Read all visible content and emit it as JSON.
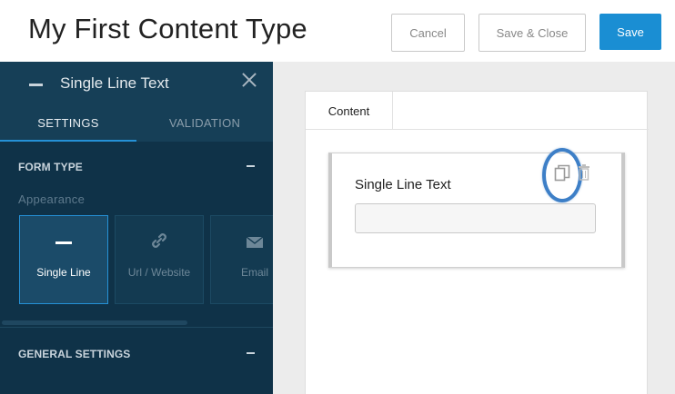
{
  "header": {
    "title": "My First Content Type",
    "cancel_label": "Cancel",
    "save_close_label": "Save & Close",
    "save_label": "Save"
  },
  "sidebar": {
    "field_title": "Single Line Text",
    "tabs": [
      {
        "label": "SETTINGS",
        "active": true
      },
      {
        "label": "VALIDATION",
        "active": false
      }
    ],
    "form_type": {
      "heading": "FORM TYPE",
      "appearance_label": "Appearance",
      "options": [
        {
          "label": "Single Line",
          "icon": "dash-icon",
          "selected": true
        },
        {
          "label": "Url / Website",
          "icon": "link-icon",
          "selected": false
        },
        {
          "label": "Email",
          "icon": "envelope-icon",
          "selected": false
        }
      ]
    },
    "general_settings": {
      "heading": "GENERAL SETTINGS"
    }
  },
  "canvas": {
    "tab_label": "Content",
    "field": {
      "label": "Single Line Text",
      "value": ""
    }
  },
  "colors": {
    "accent": "#1a8ed3",
    "sidebar_bg": "#0f3248",
    "highlight_ring": "#3d7fc7"
  }
}
